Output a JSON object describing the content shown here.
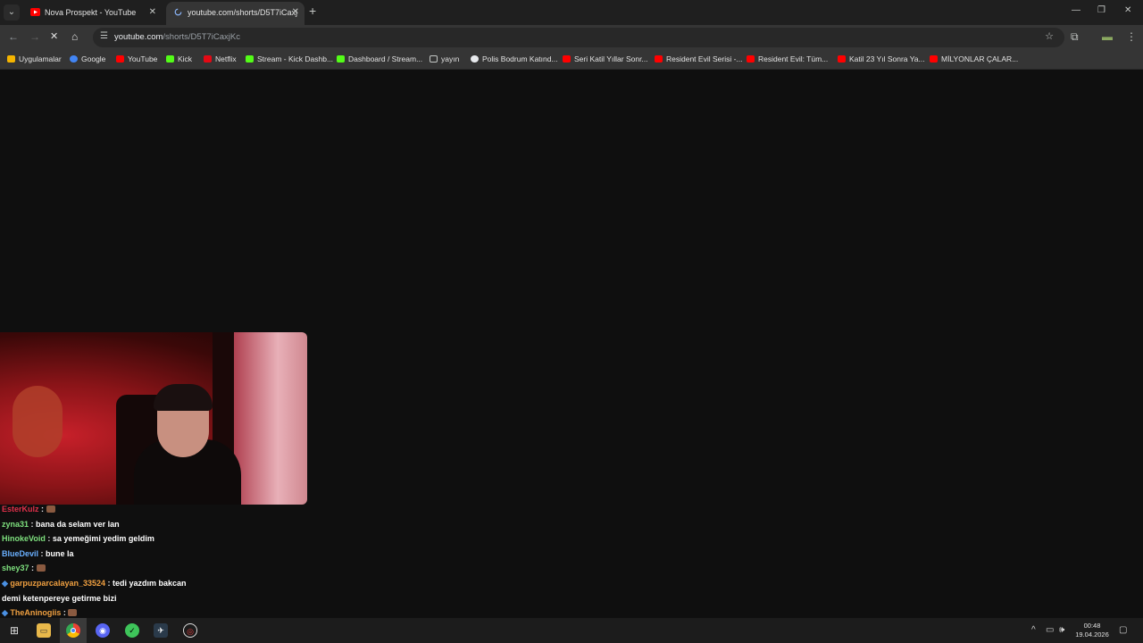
{
  "browser": {
    "tabs": [
      {
        "title": "Nova Prospekt - YouTube",
        "active": false
      },
      {
        "title": "youtube.com/shorts/D5T7iCaxj",
        "active": true
      }
    ],
    "url_host": "youtube.com",
    "url_path": "/shorts/D5T7iCaxjKc",
    "bookmarks": [
      {
        "label": "Uygulamalar",
        "icon": "apps-grid-icon",
        "color": "#f4b400"
      },
      {
        "label": "Google",
        "icon": "google-icon",
        "color": "#4285f4"
      },
      {
        "label": "YouTube",
        "icon": "youtube-icon",
        "color": "#ff0000"
      },
      {
        "label": "Kick",
        "icon": "kick-icon",
        "color": "#53fc18"
      },
      {
        "label": "Netflix",
        "icon": "netflix-icon",
        "color": "#e50914"
      },
      {
        "label": "Stream - Kick Dashb...",
        "icon": "kick-icon",
        "color": "#53fc18"
      },
      {
        "label": "Dashboard / Stream...",
        "icon": "dashboard-icon",
        "color": "#53fc18"
      },
      {
        "label": "yayın",
        "icon": "folder-icon",
        "color": "#c4c7c5"
      },
      {
        "label": "Polis Bodrum Katınd...",
        "icon": "site-icon",
        "color": "#e8eaed"
      },
      {
        "label": "Seri Katil Yıllar Sonr...",
        "icon": "youtube-icon",
        "color": "#ff0000"
      },
      {
        "label": "Resident Evil Serisi -...",
        "icon": "youtube-icon",
        "color": "#ff0000"
      },
      {
        "label": "Resident Evil: Tüm...",
        "icon": "youtube-icon",
        "color": "#ff0000"
      },
      {
        "label": "Katil 23 Yıl Sonra Ya...",
        "icon": "youtube-icon",
        "color": "#ff0000"
      },
      {
        "label": "MİLYONLAR ÇALAR...",
        "icon": "youtube-icon",
        "color": "#ff0000"
      }
    ]
  },
  "chat": [
    {
      "user": "EsterKulz",
      "user_color": "#e0304a",
      "message": "",
      "emote": true
    },
    {
      "user": "zyna31",
      "user_color": "#7ee07e",
      "message": "bana da selam ver lan",
      "emote": false
    },
    {
      "user": "HinokeVoid",
      "user_color": "#7ee07e",
      "message": "sa yemeğimi yedim geldim",
      "emote": false
    },
    {
      "user": "BlueDevil",
      "user_color": "#6ab0ff",
      "message": "bune la",
      "emote": false
    },
    {
      "user": "shey37",
      "user_color": "#7ee07e",
      "message": "",
      "emote": true
    },
    {
      "user": "garpuzparcalayan_33524",
      "user_color": "#f0a040",
      "message": "tedi yazdım bakcan",
      "emote": false,
      "badge": true
    },
    {
      "user": "",
      "user_color": "#ffffff",
      "message": "demi ketenpereye getirme bizi",
      "emote": false
    },
    {
      "user": "TheAninogiis",
      "user_color": "#f0a040",
      "message": "",
      "emote": true,
      "badge": true
    }
  ],
  "taskbar": {
    "time": "00:48",
    "date": "19.04.2026"
  }
}
